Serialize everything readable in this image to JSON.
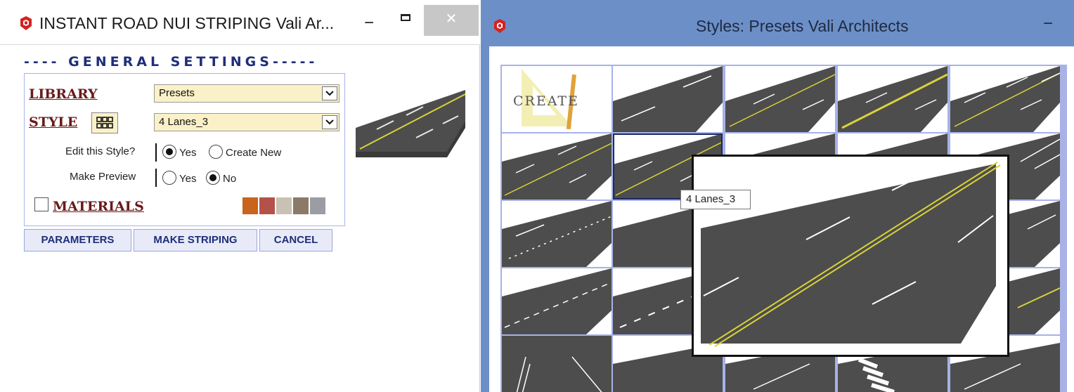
{
  "left_window": {
    "title": "INSTANT ROAD NUI STRIPING  Vali Ar...",
    "minimize": "−",
    "close": "✕",
    "settings_header": "---- GENERAL SETTINGS-----",
    "library_label": "LIBRARY",
    "library_value": "Presets",
    "style_label": "STYLE",
    "style_value": "4 Lanes_3",
    "edit_style_label": "Edit this Style?",
    "edit_style_options": [
      "Yes",
      "Create New"
    ],
    "edit_style_selected": "Yes",
    "make_preview_label": "Make Preview",
    "make_preview_options": [
      "Yes",
      "No"
    ],
    "make_preview_selected": "No",
    "materials_label": "MATERIALS",
    "materials_checked": false,
    "material_swatches": [
      "#c8641c",
      "#b4524a",
      "#c9c2b4",
      "#8c7a68",
      "#9c9ca4"
    ],
    "buttons": {
      "parameters": "PARAMETERS",
      "make_striping": "MAKE STRIPING",
      "cancel": "CANCEL"
    }
  },
  "right_window": {
    "title": "Styles: Presets    Vali Architects",
    "minimize": "−",
    "create_label": "CREATE",
    "tooltip": "4 Lanes_3",
    "selected_style": "4 Lanes_3"
  },
  "colors": {
    "accent": "#1f2e7a",
    "link": "#6a1a1a",
    "asphalt": "#4d4d4d",
    "yellow_line": "#d7d23a",
    "window_frame": "#6c8fc8",
    "grid_lines": "#a8b2e6",
    "select_bg": "#fbf1c8"
  }
}
